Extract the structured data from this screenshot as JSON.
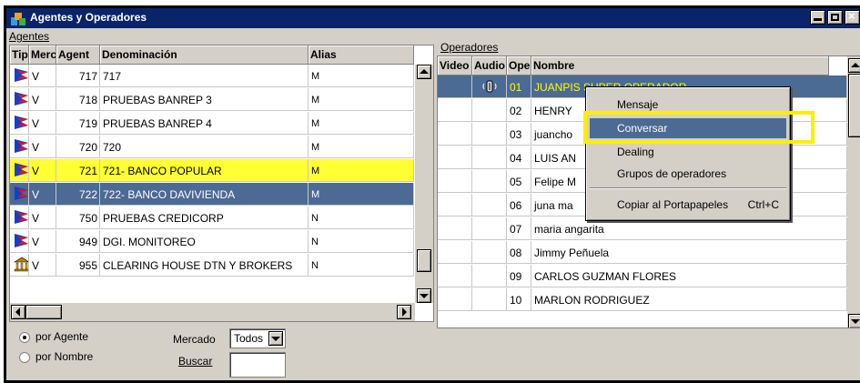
{
  "window": {
    "title": "Agentes y Operadores",
    "controls": [
      "minimize-window-button",
      "maximize-window-button",
      "close-window-button"
    ]
  },
  "agentes": {
    "section_label": "Agentes",
    "columns": [
      "Tipo",
      "Merc",
      "Agent",
      "Denominación",
      "Alias"
    ],
    "rows": [
      {
        "tipo_icon": "flag-icon",
        "merc": "V",
        "agent": "717",
        "denominacion": "717",
        "alias": "M",
        "state": "normal"
      },
      {
        "tipo_icon": "flag-icon",
        "merc": "V",
        "agent": "718",
        "denominacion": "PRUEBAS BANREP 3",
        "alias": "M",
        "state": "normal"
      },
      {
        "tipo_icon": "flag-icon",
        "merc": "V",
        "agent": "719",
        "denominacion": "PRUEBAS BANREP 4",
        "alias": "M",
        "state": "normal"
      },
      {
        "tipo_icon": "flag-icon",
        "merc": "V",
        "agent": "720",
        "denominacion": "720",
        "alias": "M",
        "state": "normal"
      },
      {
        "tipo_icon": "flag-icon",
        "merc": "V",
        "agent": "721",
        "denominacion": "721- BANCO POPULAR",
        "alias": "M",
        "state": "highlighted"
      },
      {
        "tipo_icon": "flag-icon",
        "merc": "V",
        "agent": "722",
        "denominacion": "722- BANCO DAVIVIENDA",
        "alias": "M",
        "state": "selected"
      },
      {
        "tipo_icon": "flag-icon",
        "merc": "V",
        "agent": "750",
        "denominacion": "PRUEBAS CREDICORP",
        "alias": "N",
        "state": "normal"
      },
      {
        "tipo_icon": "flag-icon",
        "merc": "V",
        "agent": "949",
        "denominacion": "DGI. MONITOREO",
        "alias": "N",
        "state": "normal"
      },
      {
        "tipo_icon": "bank-building-icon",
        "merc": "V",
        "agent": "955",
        "denominacion": "CLEARING HOUSE DTN Y BROKERS",
        "alias": "N",
        "state": "normal"
      }
    ]
  },
  "operadores": {
    "section_label": "Operadores",
    "columns": [
      "Video",
      "Audio",
      "Oper",
      "Nombre"
    ],
    "rows": [
      {
        "oper": "01",
        "nombre": "JUANPIS SUPER OPERADOR",
        "state": "selected",
        "audio_icon": "speaker-icon"
      },
      {
        "oper": "02",
        "nombre": "HENRY",
        "state": "normal"
      },
      {
        "oper": "03",
        "nombre": "juancho",
        "state": "normal"
      },
      {
        "oper": "04",
        "nombre": "LUIS AN",
        "state": "normal"
      },
      {
        "oper": "05",
        "nombre": "Felipe M",
        "state": "normal"
      },
      {
        "oper": "06",
        "nombre": "juna ma",
        "state": "normal"
      },
      {
        "oper": "07",
        "nombre": "maria angarita",
        "state": "normal"
      },
      {
        "oper": "08",
        "nombre": "Jimmy Peñuela",
        "state": "normal"
      },
      {
        "oper": "09",
        "nombre": "CARLOS GUZMAN FLORES",
        "state": "normal"
      },
      {
        "oper": "10",
        "nombre": "MARLON RODRIGUEZ",
        "state": "normal"
      }
    ]
  },
  "context_menu": {
    "items": [
      {
        "label": "Mensaje",
        "shortcut": "",
        "state": "normal"
      },
      {
        "label": "Conversar",
        "shortcut": "",
        "state": "hover"
      },
      {
        "label": "Dealing",
        "shortcut": "",
        "state": "normal"
      },
      {
        "label": "Grupos de operadores",
        "shortcut": "",
        "state": "normal"
      },
      {
        "label": "Copiar al Portapapeles",
        "shortcut": "Ctrl+C",
        "state": "normal"
      }
    ],
    "highlight_color": "#ffee00"
  },
  "footer": {
    "radio_agente": "por Agente",
    "radio_nombre": "por Nombre",
    "radio_selected": "por Agente",
    "mercado_label": "Mercado",
    "mercado_value": "Todos",
    "buscar_label": "Buscar",
    "buscar_value": ""
  },
  "colors": {
    "title_bar": "#0a246a",
    "selected_row": "#4b6a94",
    "highlighted_row": "#ffff33",
    "window_bg": "#d4d0c8"
  }
}
